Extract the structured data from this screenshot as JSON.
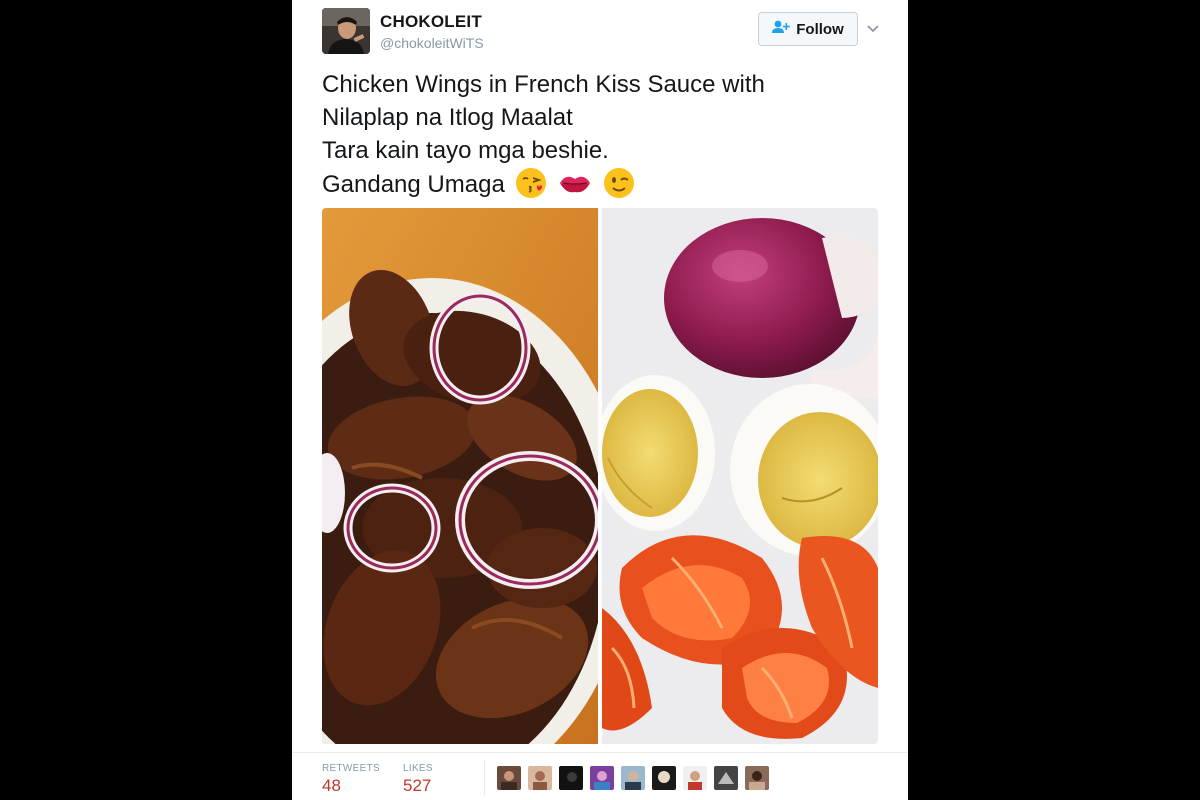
{
  "tweet": {
    "display_name": "CHOKOLEIT",
    "handle": "@chokoleitWiTS",
    "follow_label": "Follow",
    "text_lines": [
      "Chicken Wings in French Kiss Sauce with",
      "Nilaplap na Itlog Maalat",
      "Tara kain tayo mga beshie.",
      "Gandang Umaga"
    ],
    "emojis": [
      "kissing-face-emoji",
      "kiss-mark-emoji",
      "winking-face-emoji"
    ]
  },
  "stats": {
    "retweets_label": "RETWEETS",
    "retweets_value": "48",
    "likes_label": "LIKES",
    "likes_value": "527"
  },
  "likers_count_shown": 9,
  "colors": {
    "count": "#c0392b",
    "follow_border": "#c7d1d9",
    "muted": "#8899a6"
  }
}
